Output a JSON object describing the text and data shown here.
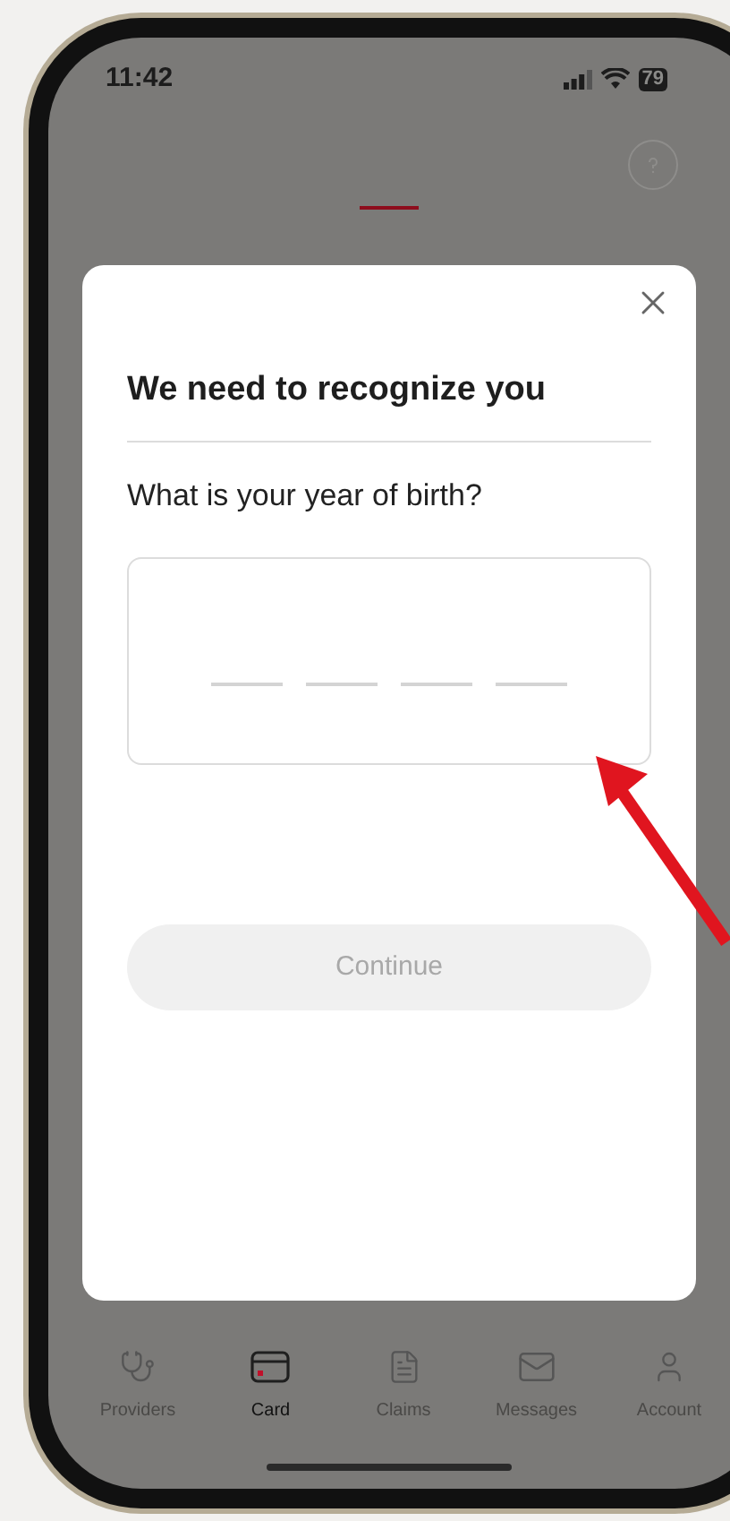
{
  "status_bar": {
    "time": "11:42",
    "battery": "79"
  },
  "modal": {
    "title": "We need to recognize you",
    "question": "What is your year of birth?",
    "slots": [
      {
        "filled": false
      },
      {
        "filled": false
      },
      {
        "filled": false
      },
      {
        "filled": false
      }
    ],
    "continue": {
      "label": "Continue",
      "disabled": true
    }
  },
  "tab_bar": [
    {
      "kind": "providers",
      "label": "Providers",
      "selected": false
    },
    {
      "kind": "card",
      "label": "Card",
      "selected": true
    },
    {
      "kind": "claims",
      "label": "Claims",
      "selected": false
    },
    {
      "kind": "messages",
      "label": "Messages",
      "selected": false
    },
    {
      "kind": "account",
      "label": "Account",
      "selected": false
    }
  ]
}
